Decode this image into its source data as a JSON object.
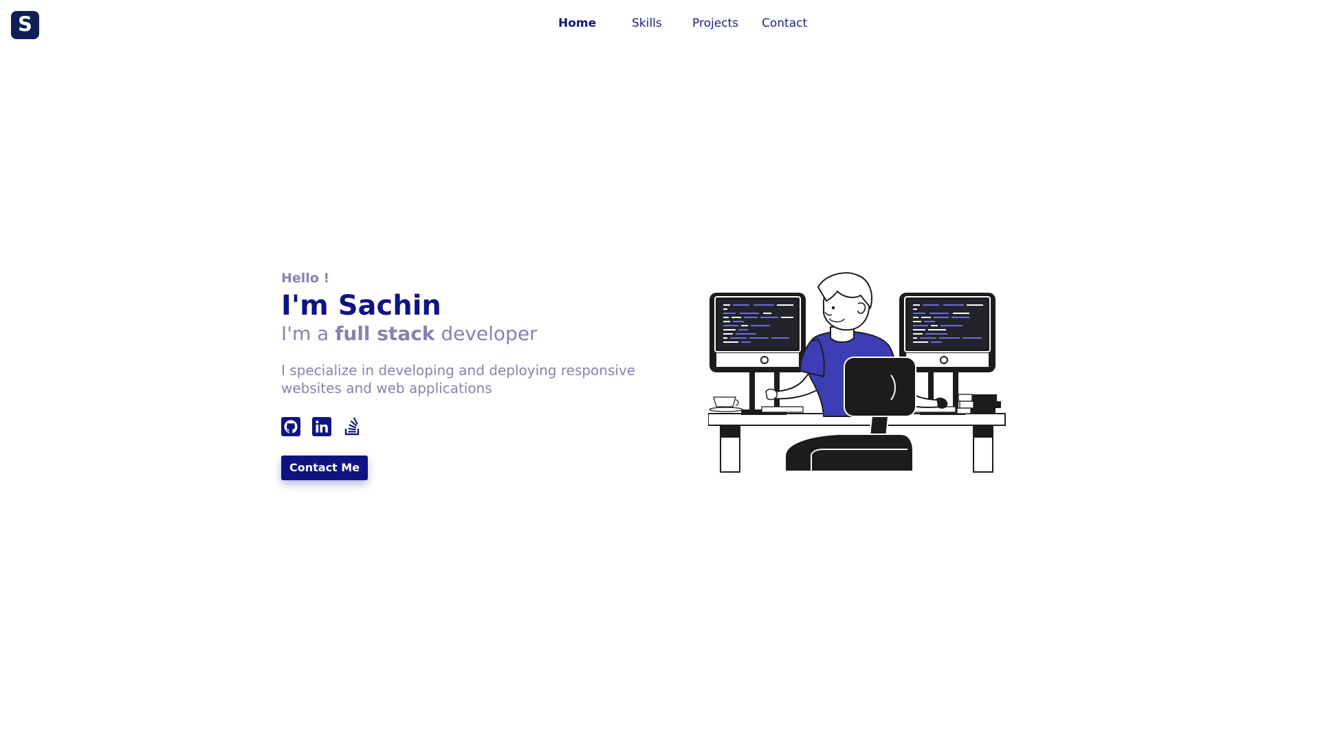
{
  "brand": {
    "logo_letter": "S",
    "colors": {
      "primary": "#0f1482",
      "logo_bg": "#0f1e56",
      "muted": "#8c7fb0",
      "accent_shirt": "#3d3db5"
    }
  },
  "nav": {
    "items": [
      {
        "label": "Home",
        "active": true
      },
      {
        "label": "Skills",
        "active": false
      },
      {
        "label": "Projects",
        "active": false
      },
      {
        "label": "Contact",
        "active": false
      }
    ]
  },
  "hero": {
    "greeting": "Hello !",
    "name": "I'm Sachin",
    "role_prefix": "I'm a ",
    "role_highlight": "full stack",
    "role_suffix": " developer",
    "description": "I specialize in developing and deploying responsive websites and web applications",
    "socials": [
      {
        "icon": "github-icon"
      },
      {
        "icon": "linkedin-icon"
      },
      {
        "icon": "stackoverflow-icon"
      }
    ],
    "cta_label": "Contact Me"
  },
  "illustration": {
    "subject": "developer-at-two-monitors"
  }
}
